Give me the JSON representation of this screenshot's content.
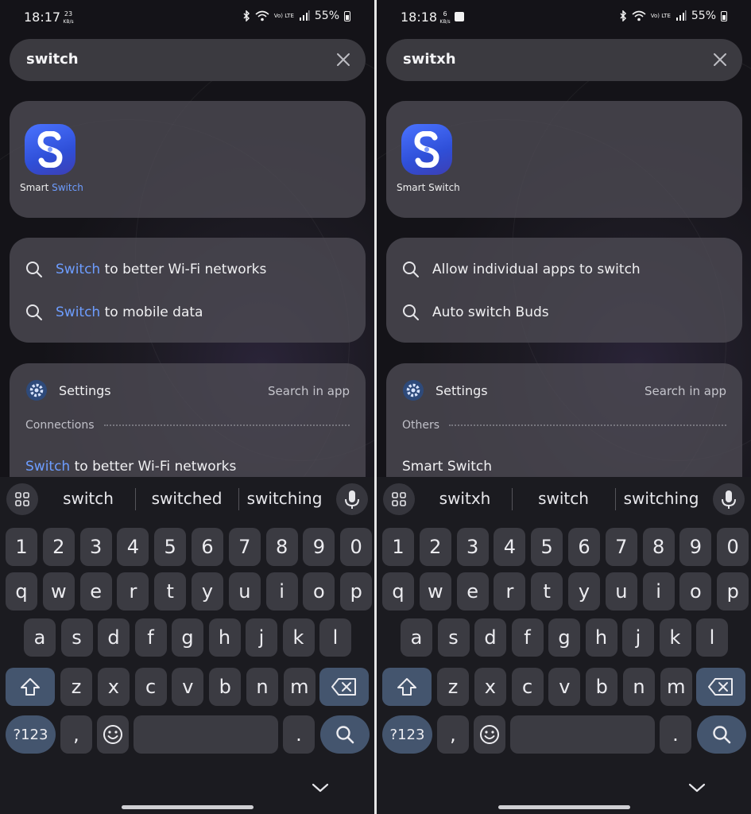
{
  "screens": [
    {
      "status": {
        "time": "18:17",
        "speed_value": "23",
        "speed_unit": "KB/s",
        "volte": "Vo) LTE",
        "battery": "55%"
      },
      "search": {
        "query": "switch"
      },
      "apps": [
        {
          "name_plain": "Smart ",
          "name_match": "Switch"
        }
      ],
      "suggestions": [
        {
          "match": "Switch",
          "rest": " to better Wi-Fi networks"
        },
        {
          "match": "Switch",
          "rest": " to mobile data"
        }
      ],
      "settings": {
        "title": "Settings",
        "search_in_app": "Search in app",
        "section": "Connections",
        "result_match": "Switch",
        "result_rest": " to better Wi-Fi networks"
      },
      "keyboard": {
        "predictions": [
          "switch",
          "switched",
          "switching"
        ]
      }
    },
    {
      "status": {
        "time": "18:18",
        "speed_value": "6",
        "speed_unit": "KB/s",
        "volte": "Vo) LTE",
        "battery": "55%"
      },
      "search": {
        "query": "switxh"
      },
      "apps": [
        {
          "name_plain": "Smart Switch",
          "name_match": ""
        }
      ],
      "suggestions": [
        {
          "match": "",
          "rest": "Allow individual apps to switch"
        },
        {
          "match": "",
          "rest": "Auto switch Buds"
        }
      ],
      "settings": {
        "title": "Settings",
        "search_in_app": "Search in app",
        "section": "Others",
        "result_match": "",
        "result_rest": "Smart Switch"
      },
      "keyboard": {
        "predictions": [
          "switxh",
          "switch",
          "switching"
        ]
      }
    }
  ],
  "keyboard_layout": {
    "number_row": [
      "1",
      "2",
      "3",
      "4",
      "5",
      "6",
      "7",
      "8",
      "9",
      "0"
    ],
    "row1": [
      "q",
      "w",
      "e",
      "r",
      "t",
      "y",
      "u",
      "i",
      "o",
      "p"
    ],
    "row2": [
      "a",
      "s",
      "d",
      "f",
      "g",
      "h",
      "j",
      "k",
      "l"
    ],
    "row3": [
      "z",
      "x",
      "c",
      "v",
      "b",
      "n",
      "m"
    ],
    "symbols_key": "?123",
    "comma_key": ",",
    "period_key": "."
  },
  "icons": [
    "bluetooth-icon",
    "wifi-icon",
    "signal-icon",
    "battery-icon",
    "gallery-icon",
    "clear-icon",
    "search-icon",
    "gear-icon",
    "grid-icon",
    "mic-icon",
    "shift-icon",
    "backspace-icon",
    "emoji-icon",
    "chevron-down-icon"
  ],
  "colors": {
    "match_highlight": "#6d9dff",
    "app_icon": "#3f5ff0",
    "action_key": "#44556e"
  }
}
